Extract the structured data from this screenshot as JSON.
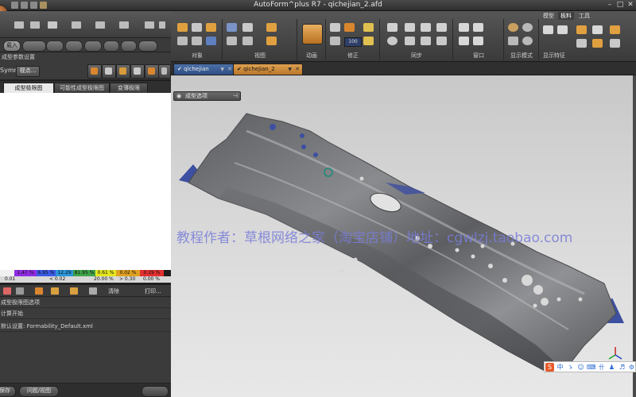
{
  "window": {
    "title": "AutoForm^plus R7 - qichejian_2.afd"
  },
  "ribbon": {
    "tabs": [
      "模型",
      "板料",
      "工具"
    ],
    "active_tab": "板料",
    "groups": [
      "对象",
      "视图",
      "动画",
      "修正",
      "同步",
      "窗口",
      "显示模式",
      "显示特征"
    ],
    "small_combo": "100"
  },
  "left_panel": {
    "toolbar_pill": "载入",
    "setup_label": "成型参数设置",
    "view_label": "Symm",
    "view_combo": "视点...",
    "tabs": [
      "成型极限图",
      "可能性成型极限图",
      "变薄极限"
    ],
    "legend": {
      "colors": [
        "#8d2be2",
        "#3b5ae6",
        "#2a95d8",
        "#3fa34a",
        "#e6e61f",
        "#e0a020",
        "#e03030"
      ],
      "percents": [
        "1.47 %",
        "6.95 %",
        "12.29 %",
        "81.95 %",
        "0.61 %",
        "0.02 %",
        "0.19 %"
      ],
      "values": [
        "0.01",
        "< 0.02",
        "20.00 %",
        "> 0.30",
        "0.00 %"
      ]
    },
    "toolbar3": {
      "clear": "清除",
      "print": "打印..."
    },
    "rows": [
      "成型极限图选项",
      "计算开始",
      "默认设置: Formability_Default.xml"
    ],
    "status_buttons": [
      "保存",
      "问题/视图"
    ]
  },
  "documents": {
    "tabs": [
      "qichejian",
      "qichejian_2"
    ],
    "active": "qichejian_2"
  },
  "viewport": {
    "panel_title": "成型选项",
    "watermark": "教程作者：草根网络之家（淘宝店铺）地址：cgwlzj.taobao.com"
  },
  "ime_bar": {
    "items": [
      "中",
      "ゝ",
      "☺",
      "⌨",
      "卄",
      "♟",
      "♬",
      "⚙"
    ]
  },
  "colors": {
    "accent_orange": "#d9862f",
    "tab_blue": "#3e5d93",
    "part_gray": "#6f7072",
    "flange_blue": "#3d4fa0"
  }
}
